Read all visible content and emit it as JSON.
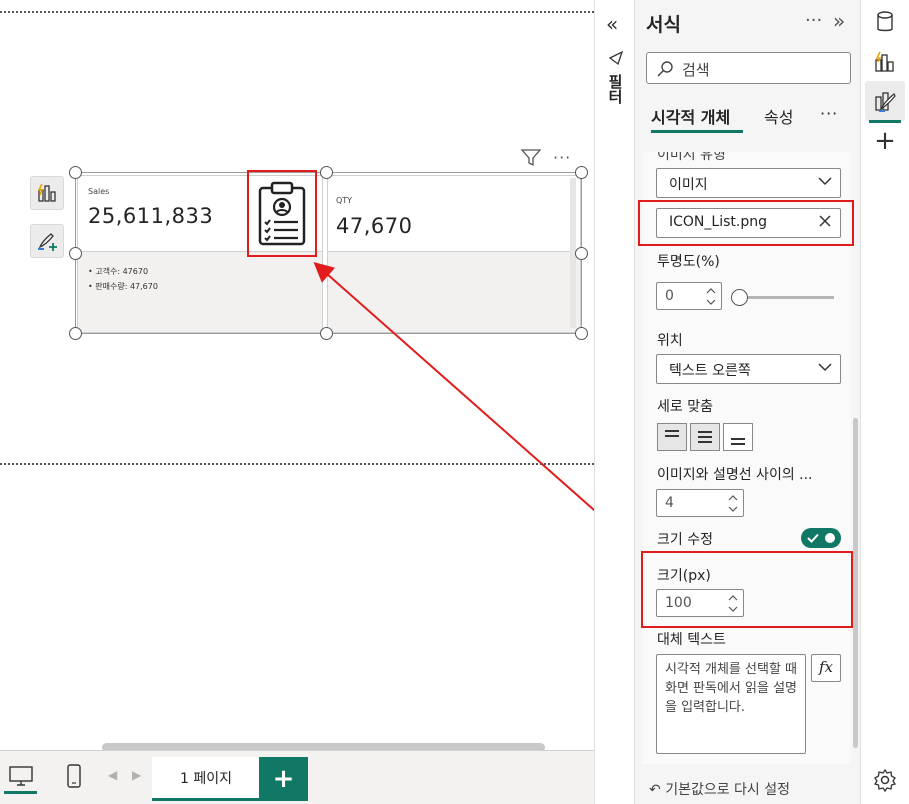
{
  "format_pane": {
    "title": "서식",
    "more": "···",
    "search_placeholder": "검색",
    "tabs": [
      "시각적 개체",
      "속성"
    ],
    "tabs_more": "···",
    "cropped_section_label": "이미지 유형",
    "image_type_value": "이미지",
    "image_file_value": "ICON_List.png",
    "transparency_label": "투명도(%)",
    "transparency_value": "0",
    "position_label": "위치",
    "position_value": "텍스트 오른쪽",
    "vertical_align_label": "세로 맞춤",
    "spacing_label": "이미지와 설명선 사이의 ...",
    "spacing_value": "4",
    "resize_label": "크기 수정",
    "size_label": "크기(px)",
    "size_value": "100",
    "alt_text_label": "대체 텍스트",
    "alt_text_placeholder": "시각적 개체를 선택할 때 화면 판독에서 읽을 설명을 입력합니다.",
    "fx_label": "fx",
    "reset_label": "기본값으로 다시 설정"
  },
  "filters_label": "필터",
  "cards": [
    {
      "label": "Sales",
      "value": "25,611,833",
      "details": [
        "• 고객수: 47670",
        "• 판매수량: 47,670"
      ]
    },
    {
      "label": "QTY",
      "value": "47,670"
    }
  ],
  "page_tab": "1 페이지",
  "add_page": "+",
  "colors": {
    "accent": "#117865",
    "highlight": "#e21b1b"
  }
}
